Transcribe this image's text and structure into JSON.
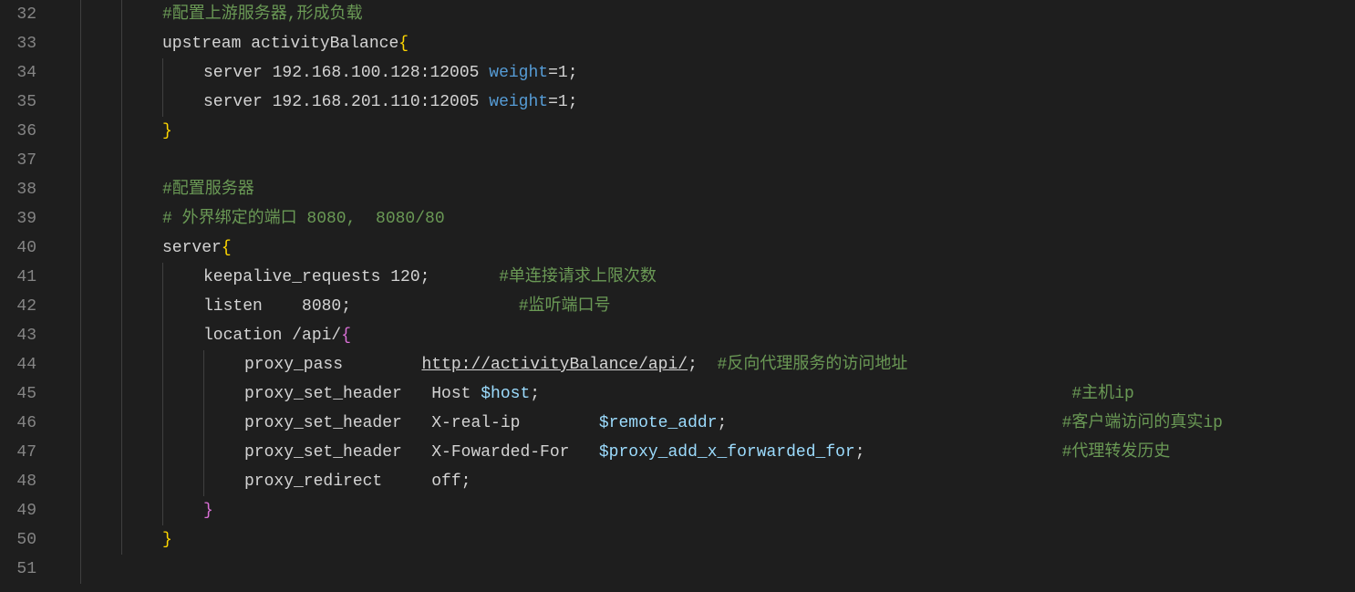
{
  "startLine": 32,
  "lines": [
    {
      "indent": 2,
      "guides": [
        0,
        1
      ],
      "tokens": [
        {
          "cls": "c-comment",
          "name": "comment",
          "text": "#配置上游服务器,形成负载"
        }
      ]
    },
    {
      "indent": 2,
      "guides": [
        0,
        1
      ],
      "tokens": [
        {
          "cls": "c-ident",
          "name": "directive",
          "text": "upstream activityBalance"
        },
        {
          "cls": "c-brace",
          "name": "open-brace",
          "text": "{"
        }
      ]
    },
    {
      "indent": 3,
      "guides": [
        0,
        1,
        2
      ],
      "tokens": [
        {
          "cls": "c-ident",
          "name": "directive",
          "text": "server 192.168.100.128:12005 "
        },
        {
          "cls": "c-prop",
          "name": "param",
          "text": "weight"
        },
        {
          "cls": "c-ident",
          "name": "value",
          "text": "=1"
        },
        {
          "cls": "c-punct",
          "name": "semicolon",
          "text": ";"
        }
      ]
    },
    {
      "indent": 3,
      "guides": [
        0,
        1,
        2
      ],
      "tokens": [
        {
          "cls": "c-ident",
          "name": "directive",
          "text": "server 192.168.201.110:12005 "
        },
        {
          "cls": "c-prop",
          "name": "param",
          "text": "weight"
        },
        {
          "cls": "c-ident",
          "name": "value",
          "text": "=1"
        },
        {
          "cls": "c-punct",
          "name": "semicolon",
          "text": ";"
        }
      ]
    },
    {
      "indent": 2,
      "guides": [
        0,
        1
      ],
      "tokens": [
        {
          "cls": "c-brace",
          "name": "close-brace",
          "text": "}"
        }
      ]
    },
    {
      "indent": 0,
      "guides": [
        0,
        1
      ],
      "tokens": []
    },
    {
      "indent": 2,
      "guides": [
        0,
        1
      ],
      "tokens": [
        {
          "cls": "c-comment",
          "name": "comment",
          "text": "#配置服务器"
        }
      ]
    },
    {
      "indent": 2,
      "guides": [
        0,
        1
      ],
      "tokens": [
        {
          "cls": "c-comment",
          "name": "comment",
          "text": "# 外界绑定的端口 8080,  8080/80"
        }
      ]
    },
    {
      "indent": 2,
      "guides": [
        0,
        1
      ],
      "tokens": [
        {
          "cls": "c-ident",
          "name": "directive",
          "text": "server"
        },
        {
          "cls": "c-brace",
          "name": "open-brace",
          "text": "{"
        }
      ]
    },
    {
      "indent": 3,
      "guides": [
        0,
        1,
        2
      ],
      "tokens": [
        {
          "cls": "c-ident",
          "name": "directive",
          "text": "keepalive_requests 120"
        },
        {
          "cls": "c-punct",
          "name": "semicolon",
          "text": ";"
        },
        {
          "cls": "c-ident",
          "name": "spacer",
          "text": "       "
        },
        {
          "cls": "c-comment",
          "name": "comment",
          "text": "#单连接请求上限次数"
        }
      ]
    },
    {
      "indent": 3,
      "guides": [
        0,
        1,
        2
      ],
      "tokens": [
        {
          "cls": "c-ident",
          "name": "directive",
          "text": "listen    8080"
        },
        {
          "cls": "c-punct",
          "name": "semicolon",
          "text": ";"
        },
        {
          "cls": "c-ident",
          "name": "spacer",
          "text": "                 "
        },
        {
          "cls": "c-comment",
          "name": "comment",
          "text": "#监听端口号"
        }
      ]
    },
    {
      "indent": 3,
      "guides": [
        0,
        1,
        2
      ],
      "tokens": [
        {
          "cls": "c-ident",
          "name": "directive",
          "text": "location /api/"
        },
        {
          "cls": "c-brace2",
          "name": "open-brace",
          "text": "{"
        }
      ]
    },
    {
      "indent": 4,
      "guides": [
        0,
        1,
        2,
        3
      ],
      "tokens": [
        {
          "cls": "c-ident",
          "name": "directive",
          "text": "proxy_pass        "
        },
        {
          "cls": "c-url",
          "name": "url",
          "text": "http://activityBalance/api/"
        },
        {
          "cls": "c-punct",
          "name": "semicolon",
          "text": ";"
        },
        {
          "cls": "c-ident",
          "name": "spacer",
          "text": "  "
        },
        {
          "cls": "c-comment",
          "name": "comment",
          "text": "#反向代理服务的访问地址"
        }
      ]
    },
    {
      "indent": 4,
      "guides": [
        0,
        1,
        2,
        3
      ],
      "tokens": [
        {
          "cls": "c-ident",
          "name": "directive",
          "text": "proxy_set_header   Host "
        },
        {
          "cls": "c-var",
          "name": "variable",
          "text": "$host"
        },
        {
          "cls": "c-punct",
          "name": "semicolon",
          "text": ";"
        },
        {
          "cls": "c-ident",
          "name": "spacer",
          "text": "                                                      "
        },
        {
          "cls": "c-comment",
          "name": "comment",
          "text": "#主机ip"
        }
      ]
    },
    {
      "indent": 4,
      "guides": [
        0,
        1,
        2,
        3
      ],
      "tokens": [
        {
          "cls": "c-ident",
          "name": "directive",
          "text": "proxy_set_header   X-real-ip        "
        },
        {
          "cls": "c-var",
          "name": "variable",
          "text": "$remote_addr"
        },
        {
          "cls": "c-punct",
          "name": "semicolon",
          "text": ";"
        },
        {
          "cls": "c-ident",
          "name": "spacer",
          "text": "                                  "
        },
        {
          "cls": "c-comment",
          "name": "comment",
          "text": "#客户端访问的真实ip"
        }
      ]
    },
    {
      "indent": 4,
      "guides": [
        0,
        1,
        2,
        3
      ],
      "tokens": [
        {
          "cls": "c-ident",
          "name": "directive",
          "text": "proxy_set_header   X-Fowarded-For   "
        },
        {
          "cls": "c-var",
          "name": "variable",
          "text": "$proxy_add_x_forwarded_for"
        },
        {
          "cls": "c-punct",
          "name": "semicolon",
          "text": ";"
        },
        {
          "cls": "c-ident",
          "name": "spacer",
          "text": "                    "
        },
        {
          "cls": "c-comment",
          "name": "comment",
          "text": "#代理转发历史"
        }
      ]
    },
    {
      "indent": 4,
      "guides": [
        0,
        1,
        2,
        3
      ],
      "tokens": [
        {
          "cls": "c-ident",
          "name": "directive",
          "text": "proxy_redirect     off"
        },
        {
          "cls": "c-punct",
          "name": "semicolon",
          "text": ";"
        }
      ]
    },
    {
      "indent": 3,
      "guides": [
        0,
        1,
        2
      ],
      "tokens": [
        {
          "cls": "c-brace2",
          "name": "close-brace",
          "text": "}"
        }
      ]
    },
    {
      "indent": 2,
      "guides": [
        0,
        1
      ],
      "tokens": [
        {
          "cls": "c-brace",
          "name": "close-brace",
          "text": "}"
        }
      ]
    },
    {
      "indent": 0,
      "guides": [
        0
      ],
      "tokens": []
    }
  ],
  "indentWidth": 45,
  "baseIndentPx": 20
}
